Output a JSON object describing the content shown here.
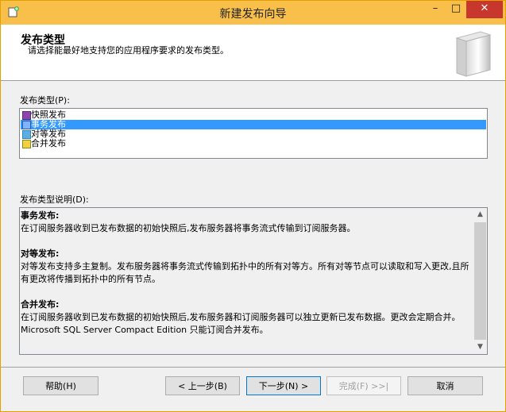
{
  "window": {
    "title": "新建发布向导",
    "controls": {
      "minimize": "–",
      "maximize": "□",
      "close": "✕"
    }
  },
  "header": {
    "title": "发布类型",
    "subtitle": "请选择能最好地支持您的应用程序要求的发布类型。"
  },
  "publication_type": {
    "label": "发布类型(P):",
    "items": [
      {
        "label": "快照发布",
        "icon": "snapshot-publication-icon",
        "selected": false
      },
      {
        "label": "事务发布",
        "icon": "transactional-publication-icon",
        "selected": true
      },
      {
        "label": "对等发布",
        "icon": "peer-publication-icon",
        "selected": false
      },
      {
        "label": "合并发布",
        "icon": "merge-publication-icon",
        "selected": false
      }
    ]
  },
  "description": {
    "label": "发布类型说明(D):",
    "sections": [
      {
        "title": "事务发布:",
        "body": "在订阅服务器收到已发布数据的初始快照后,发布服务器将事务流式传输到订阅服务器。"
      },
      {
        "title": "对等发布:",
        "body": "对等发布支持多主复制。发布服务器将事务流式传输到拓扑中的所有对等方。所有对等节点可以读取和写入更改,且所有更改将传播到拓扑中的所有节点。"
      },
      {
        "title": "合并发布:",
        "body": "在订阅服务器收到已发布数据的初始快照后,发布服务器和订阅服务器可以独立更新已发布数据。更改会定期合并。Microsoft SQL Server Compact Edition 只能订阅合并发布。"
      }
    ]
  },
  "buttons": {
    "help": "帮助(H)",
    "back": "< 上一步(B)",
    "next": "下一步(N) >",
    "finish": "完成(F) >>|",
    "cancel": "取消"
  },
  "colors": {
    "titlebar": "#f8c04a",
    "close": "#c7372d",
    "selection": "#3399ff"
  }
}
